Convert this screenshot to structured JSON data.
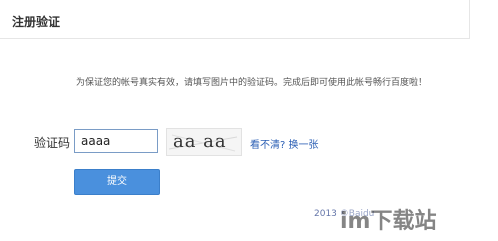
{
  "header": {
    "title": "注册验证"
  },
  "notice": {
    "text": "为保证您的帐号真实有效，请填写图片中的验证码。完成后即可使用此帐号畅行百度啦！"
  },
  "form": {
    "code_label": "验证码",
    "code_value": "aaaa",
    "captcha_text": "aa aa",
    "refresh_link": "看不清? 换一张",
    "submit_label": "提交"
  },
  "footer": {
    "year_text": "2013 ©Baidu"
  },
  "colors": {
    "accent": "#4a90dd",
    "link": "#2b5fb5",
    "input_border": "#7a9cc6"
  },
  "icons": {
    "watermark": "im-download-site-watermark"
  }
}
